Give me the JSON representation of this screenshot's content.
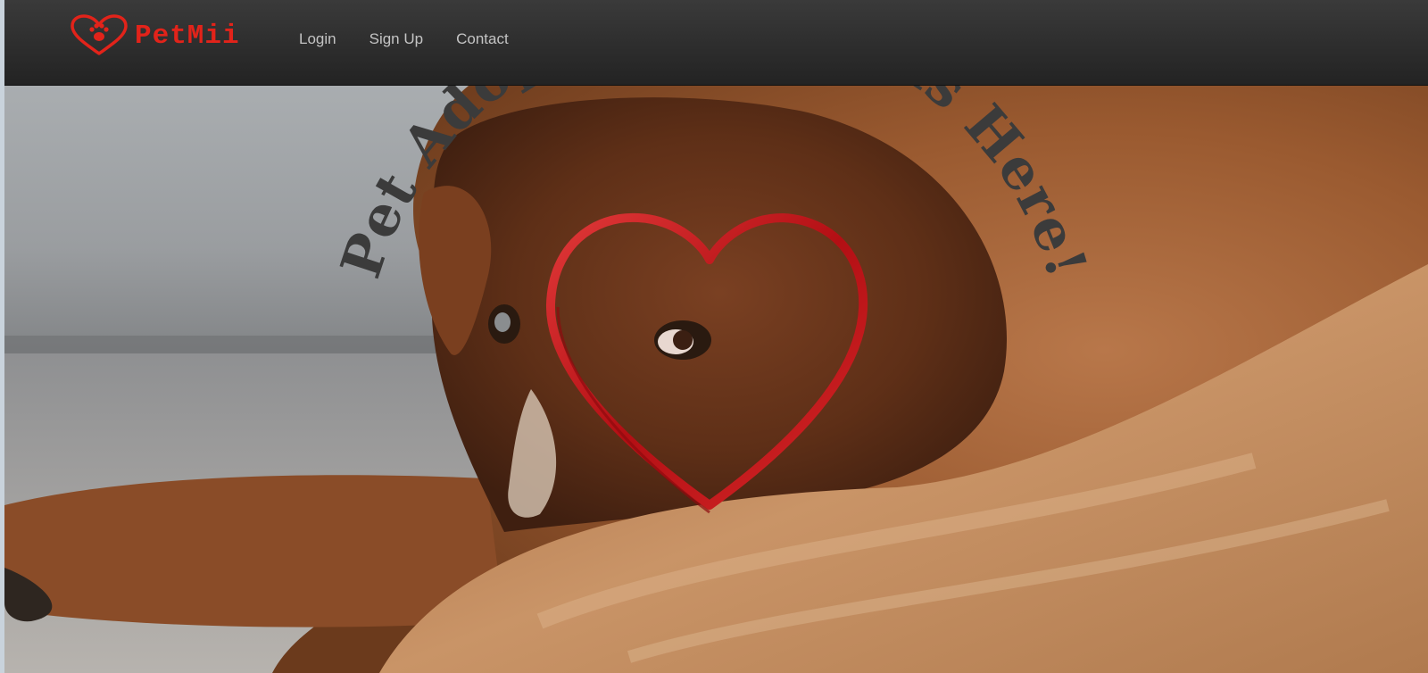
{
  "brand": {
    "name": "PetMii",
    "color": "#e2231a",
    "logo_icon": "heart-paw-icon"
  },
  "nav": {
    "links": [
      {
        "label": "Login"
      },
      {
        "label": "Sign Up"
      },
      {
        "label": "Contact"
      }
    ]
  },
  "hero": {
    "tagline": "Pet Adoption Happens Here!",
    "image": "golden-dog-lying-on-carpet",
    "emblem": "red-ribbon-heart-icon"
  }
}
